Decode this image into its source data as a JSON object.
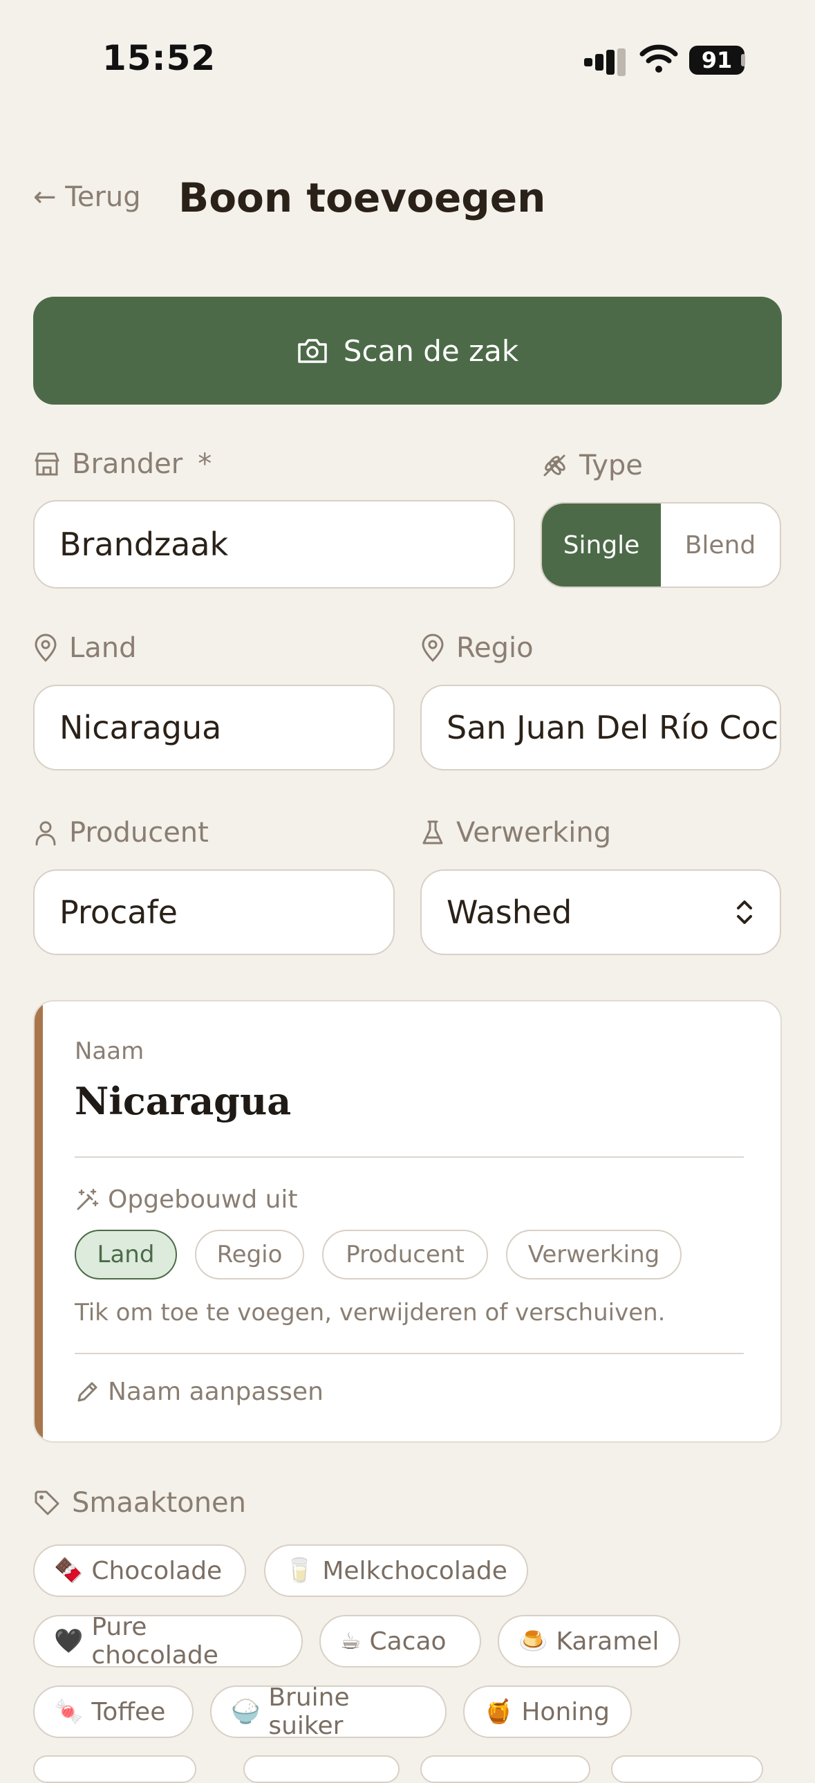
{
  "status": {
    "time": "15:52",
    "battery": "91"
  },
  "header": {
    "back_label": "← Terug",
    "title": "Boon toevoegen"
  },
  "scan_button": "Scan de zak",
  "form": {
    "brander": {
      "label": "Brander",
      "required_mark": "*",
      "value": "Brandzaak"
    },
    "type": {
      "label": "Type",
      "options": [
        "Single",
        "Blend"
      ],
      "selected": "Single"
    },
    "land": {
      "label": "Land",
      "value": "Nicaragua"
    },
    "regio": {
      "label": "Regio",
      "value": "San Juan Del Río Coco"
    },
    "producent": {
      "label": "Producent",
      "value": "Procafe"
    },
    "verwerking": {
      "label": "Verwerking",
      "value": "Washed"
    }
  },
  "naam_card": {
    "label": "Naam",
    "value": "Nicaragua",
    "built_from_label": "Opgebouwd uit",
    "chips": [
      "Land",
      "Regio",
      "Producent",
      "Verwerking"
    ],
    "active_chip": "Land",
    "hint": "Tik om toe te voegen, verwijderen of verschuiven.",
    "edit_label": "Naam aanpassen"
  },
  "smaaktonen": {
    "label": "Smaaktonen",
    "tags": [
      {
        "emoji": "🍫",
        "label": "Chocolade"
      },
      {
        "emoji": "🥛",
        "label": "Melkchocolade"
      },
      {
        "emoji": "🖤",
        "label": "Pure chocolade"
      },
      {
        "emoji": "☕",
        "label": "Cacao"
      },
      {
        "emoji": "🍮",
        "label": "Karamel"
      },
      {
        "emoji": "🍬",
        "label": "Toffee"
      },
      {
        "emoji": "🍚",
        "label": "Bruine suiker"
      },
      {
        "emoji": "🍯",
        "label": "Honing"
      }
    ]
  },
  "colors": {
    "accent": "#4c6a48",
    "card_accent": "#a9764c",
    "background": "#f4f0ea"
  }
}
